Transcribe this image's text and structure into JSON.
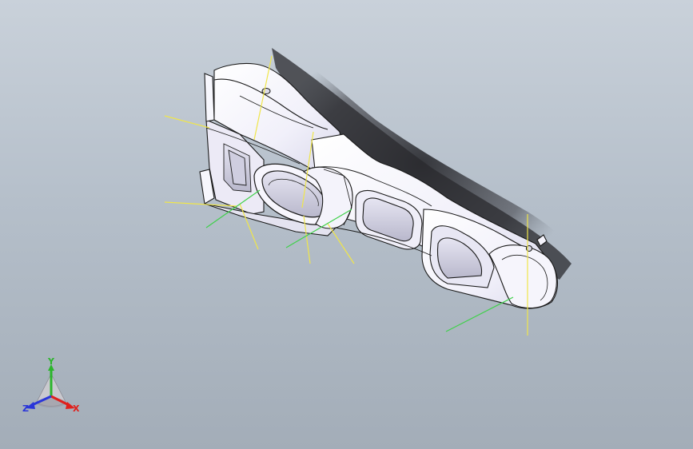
{
  "viewport": {
    "background_top": "#c9d1da",
    "background_bottom": "#a3adb8"
  },
  "model": {
    "part": "air-duct-assembly",
    "body_color": "#f3f2fb",
    "edge_color": "#1a1a1a",
    "shadow_color": "#2c2c30",
    "reference_line_colors": {
      "yellow": "#f0e64a",
      "green": "#3fd14a"
    }
  },
  "triad": {
    "x_label": "X",
    "y_label": "Y",
    "z_label": "Z",
    "x_color": "#e0201c",
    "y_color": "#2bb52b",
    "z_color": "#2a36d9"
  }
}
